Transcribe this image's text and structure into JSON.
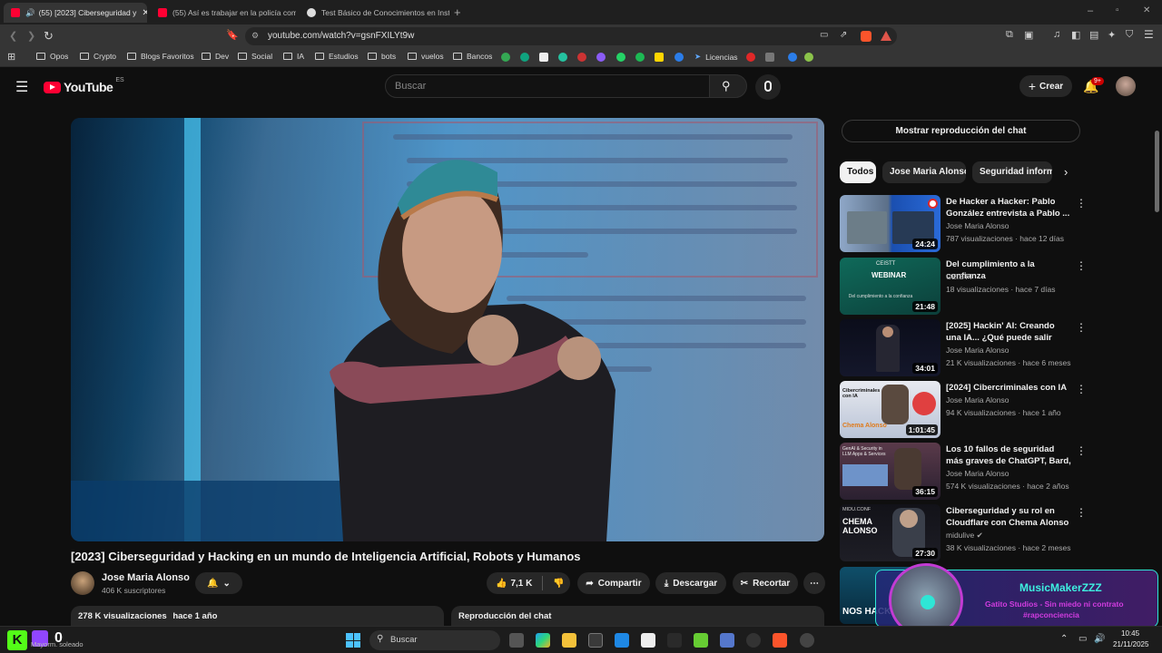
{
  "browser": {
    "tabs": [
      {
        "title": "(55) [2023] Ciberseguridad y",
        "active": true,
        "favicon_color": "#ff0033"
      },
      {
        "title": "(55) Así es trabajar en la policía como",
        "active": false,
        "favicon_color": "#ff0033"
      },
      {
        "title": "Test Básico de Conocimientos en Inst",
        "active": false,
        "favicon_color": "#bbbbbb"
      }
    ],
    "url": "youtube.com/watch?v=gsnFXILYt9w",
    "bookmarks": [
      "Opos",
      "Crypto",
      "Blogs Favoritos",
      "Dev",
      "Social",
      "IA",
      "Estudios",
      "bots",
      "vuelos",
      "Bancos"
    ],
    "bookmark_licencias": "Licencias"
  },
  "youtube": {
    "logo_text": "YouTube",
    "logo_country": "ES",
    "search_placeholder": "Buscar",
    "create_label": "Crear",
    "notifications_badge": "9+",
    "video": {
      "title": "[2023] Ciberseguridad y Hacking en un mundo de Inteligencia Artificial, Robots y Humanos",
      "channel": "Jose Maria Alonso",
      "subscribers": "406 K suscriptores",
      "likes": "7,1 K",
      "share_label": "Compartir",
      "download_label": "Descargar",
      "clip_label": "Recortar",
      "views": "278 K visualizaciones",
      "age": "hace 1 año",
      "chat_replay_label": "Reproducción del chat"
    },
    "sidebar": {
      "show_chat_label": "Mostrar reproducción del chat",
      "chips": [
        "Todos",
        "Jose Maria Alonso",
        "Seguridad informá"
      ],
      "recommendations": [
        {
          "title": "De Hacker a Hacker: Pablo González entrevista a Pablo ...",
          "channel": "Jose Maria Alonso",
          "meta": "787 visualizaciones · hace 12 días",
          "duration": "24:24"
        },
        {
          "title": "Del cumplimiento a la confianza",
          "channel": "CEISTT",
          "meta": "18 visualizaciones · hace 7 días",
          "duration": "21:48"
        },
        {
          "title": "[2025] Hackin' AI: Creando una IA... ¿Qué puede salir mal? por...",
          "channel": "Jose Maria Alonso",
          "meta": "21 K visualizaciones · hace 6 meses",
          "duration": "34:01"
        },
        {
          "title": "[2024] Cibercriminales con IA",
          "channel": "Jose Maria Alonso",
          "meta": "94 K visualizaciones · hace 1 año",
          "duration": "1:01:45"
        },
        {
          "title": "Los 10 fallos de seguridad más graves de ChatGPT, Bard, Llam...",
          "channel": "Jose Maria Alonso",
          "meta": "574 K visualizaciones · hace 2 años",
          "duration": "36:15"
        },
        {
          "title": "Ciberseguridad y su rol en Cloudflare con Chema Alonso ...",
          "channel": "midulive",
          "meta": "38 K visualizaciones · hace 2 meses",
          "duration": "27:30"
        }
      ],
      "thumb_texts": {
        "ceistt_webinar": "WEBINAR",
        "ceistt_sub": "Del cumplimiento a la confianza",
        "ceistt_brand": "CEISTT",
        "ciber_con_ia": "Cibercriminales con IA",
        "chema_alonso": "Chema Alonso",
        "genai_sec": "GenAI & Security in LLM Apps & Services",
        "midu_conf": "MIDU.CONF",
        "chema_big": "CHEMA ALONSO",
        "last_thumb": "NOS HACK"
      }
    }
  },
  "overlay": {
    "name": "MusicMakerZZZ",
    "line1": "Gatito Studios - Sin miedo ni contrato",
    "line2": "#rapconciencia"
  },
  "taskbar": {
    "weather": "Mayorm. soleado",
    "counter": "0",
    "search_label": "Buscar",
    "time": "10:45",
    "date": "21/11/2025"
  },
  "colors": {
    "yt_red": "#ff0033",
    "bg": "#0f0f0f",
    "chip_bg": "#272727",
    "overlay_accent": "#2ee6d6"
  }
}
